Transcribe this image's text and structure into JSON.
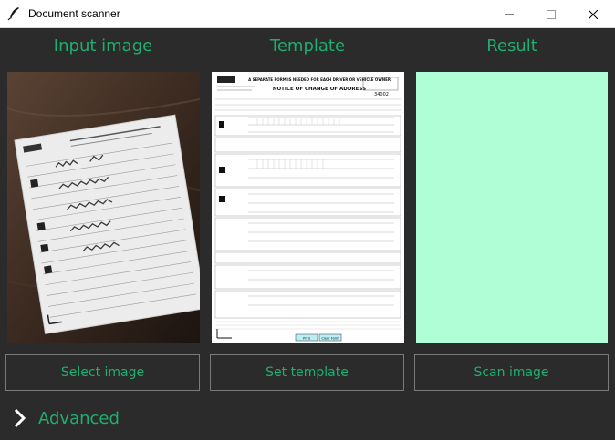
{
  "window": {
    "title": "Document scanner",
    "icons": {
      "app": "feather-icon",
      "minimize": "minimize-icon",
      "maximize": "maximize-icon",
      "close": "close-icon"
    }
  },
  "headers": {
    "input": "Input image",
    "template": "Template",
    "result": "Result"
  },
  "buttons": {
    "select_image": "Select image",
    "set_template": "Set template",
    "scan_image": "Scan image"
  },
  "advanced": {
    "label": "Advanced",
    "icon": "chevron-right-icon"
  },
  "colors": {
    "accent": "#1fae6f",
    "background": "#2b2b2b",
    "result_fill": "#b0fed6",
    "button_border": "#7a7a7a"
  },
  "template_doc": {
    "heading": "NOTICE OF CHANGE OF ADDRESS",
    "subheading": "A SEPARATE FORM IS NEEDED FOR EACH DRIVER OR VEHICLE OWNER",
    "form_number": "34002",
    "print_button": "Print",
    "clear_button": "Clear Form"
  }
}
